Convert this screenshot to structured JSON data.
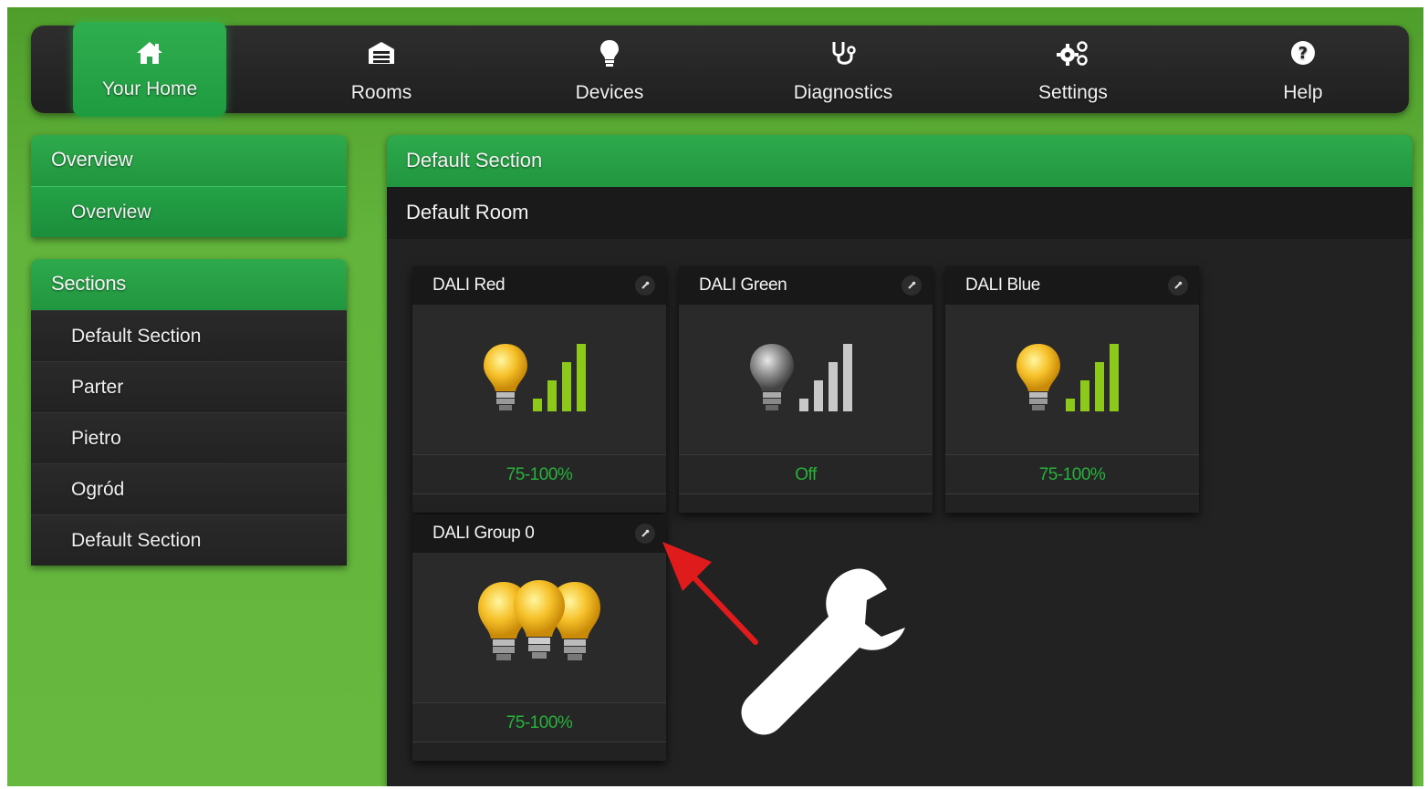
{
  "nav": {
    "items": [
      {
        "label": "Your Home",
        "icon": "home-icon",
        "active": true
      },
      {
        "label": "Rooms",
        "icon": "garage-icon",
        "active": false
      },
      {
        "label": "Devices",
        "icon": "lightbulb-icon",
        "active": false
      },
      {
        "label": "Diagnostics",
        "icon": "stethoscope-icon",
        "active": false
      },
      {
        "label": "Settings",
        "icon": "gears-icon",
        "active": false
      },
      {
        "label": "Help",
        "icon": "question-icon",
        "active": false
      }
    ]
  },
  "sidebar": {
    "overview": {
      "header": "Overview",
      "items": [
        {
          "label": "Overview",
          "selected": true
        }
      ]
    },
    "sections": {
      "header": "Sections",
      "items": [
        {
          "label": "Default Section"
        },
        {
          "label": "Parter"
        },
        {
          "label": "Pietro"
        },
        {
          "label": "Ogród"
        },
        {
          "label": "Default Section"
        }
      ]
    }
  },
  "main": {
    "section_title": "Default Section",
    "room_title": "Default Room",
    "devices": [
      {
        "name": "DALI Red",
        "status": "75-100%",
        "icon": "bulb-on-signal-icon",
        "on": true
      },
      {
        "name": "DALI Green",
        "status": "Off",
        "icon": "bulb-off-signal-icon",
        "on": false
      },
      {
        "name": "DALI Blue",
        "status": "75-100%",
        "icon": "bulb-on-signal-icon",
        "on": true
      },
      {
        "name": "DALI Group 0",
        "status": "75-100%",
        "icon": "bulb-group-icon",
        "on": true
      }
    ]
  },
  "overlay": {
    "annotation_icons": [
      "red-arrow-icon",
      "wrench-icon"
    ]
  },
  "colors": {
    "background_green": "#62b43c",
    "accent_green": "#219640",
    "status_green": "#27b23b",
    "signal_green": "#8cc91a",
    "nav_dark": "#262626"
  }
}
